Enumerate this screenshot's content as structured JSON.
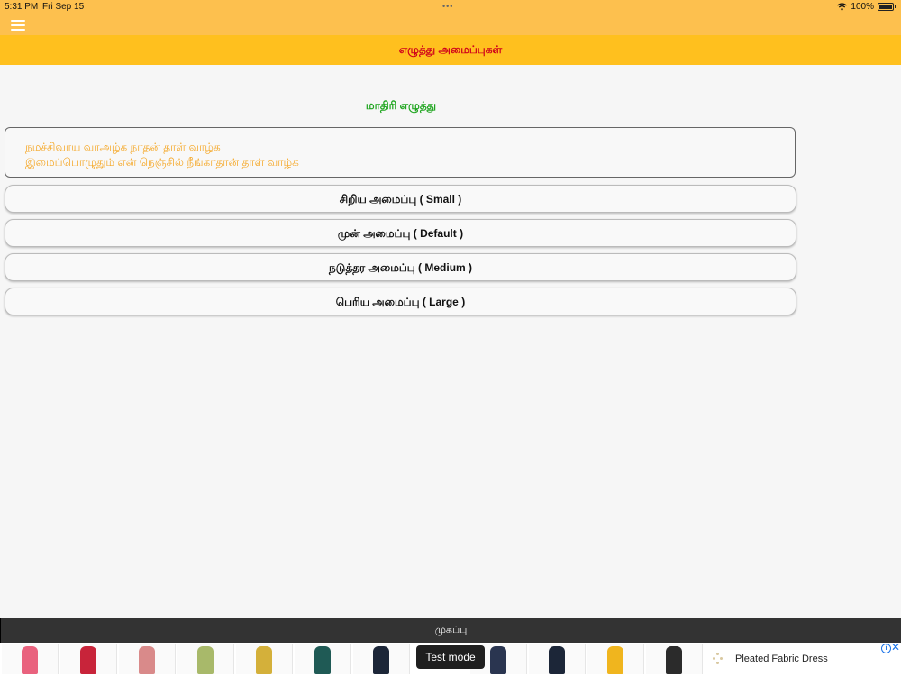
{
  "status_bar": {
    "time": "5:31 PM",
    "date": "Fri Sep 15",
    "battery": "100%"
  },
  "header": {
    "title": "எழுத்து அமைப்புகள்"
  },
  "preview": {
    "heading": "மாதிரி எழுத்து",
    "line1": "நமச்சிவாய வாஅழ்க நாதன் தாள் வாழ்க",
    "line2": "இமைப்பொழுதும் என் நெஞ்சில் நீங்காதான் தாள் வாழ்க"
  },
  "size_options": [
    {
      "label": "சிறிய அமைப்பு ( Small )"
    },
    {
      "label": "முன் அமைப்பு ( Default )"
    },
    {
      "label": "நடுத்தர அமைப்பு ( Medium )"
    },
    {
      "label": "பெரிய அமைப்பு ( Large )"
    }
  ],
  "bottom_bar": {
    "label": "முகப்பு"
  },
  "ad": {
    "test_mode_label": "Test mode",
    "product_title": "Pleated Fabric Dress"
  },
  "colors": {
    "status_bar_bg": "#fdc04e",
    "title_bar_bg": "#ffc01e",
    "title_text": "#d0021b",
    "preview_heading": "#1fa51f",
    "preview_text": "#f5a623",
    "bottom_bar_bg": "#333333"
  },
  "icons": {
    "menu": "hamburger-menu-icon",
    "wifi": "wifi-icon",
    "battery": "battery-icon",
    "ad_info": "info-icon",
    "ad_close": "close-icon"
  }
}
